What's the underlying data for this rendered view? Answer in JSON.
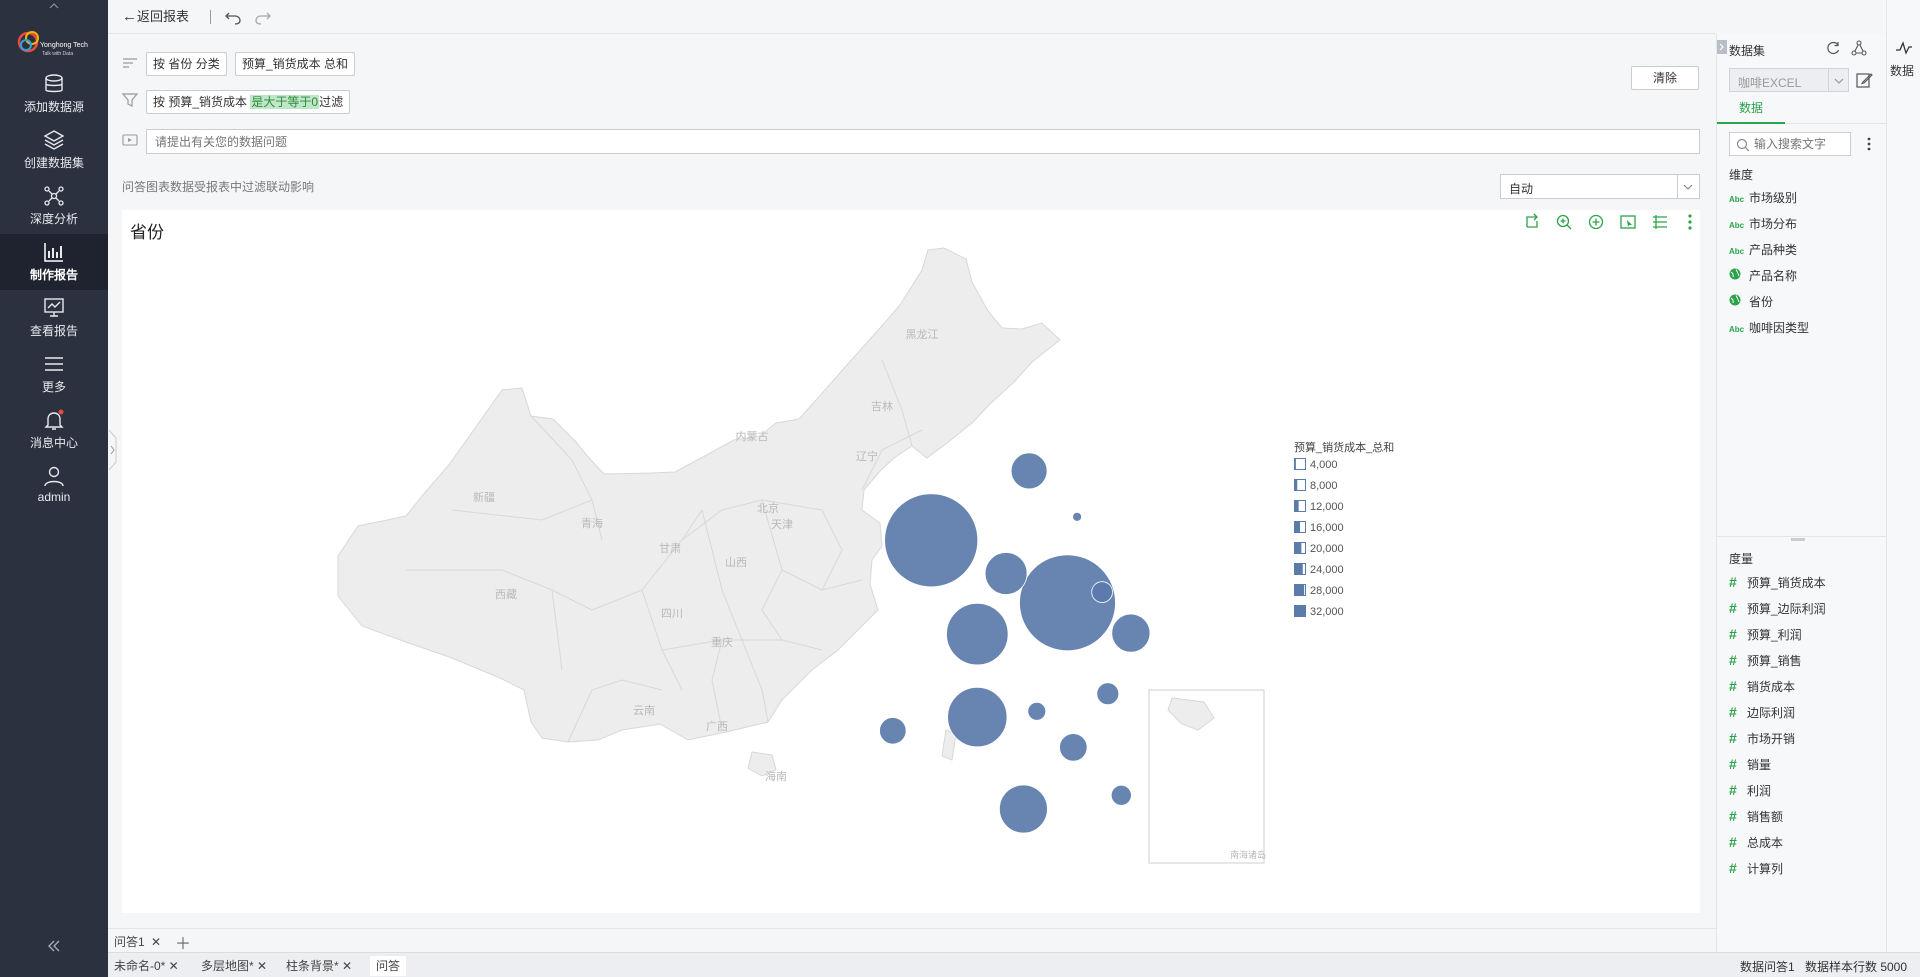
{
  "nav": {
    "items": [
      {
        "label": "添加数据源",
        "icon": "database-icon"
      },
      {
        "label": "创建数据集",
        "icon": "layers-icon"
      },
      {
        "label": "深度分析",
        "icon": "network-icon"
      },
      {
        "label": "制作报告",
        "icon": "bar-chart-icon"
      },
      {
        "label": "查看报告",
        "icon": "monitor-chart-icon"
      },
      {
        "label": "更多",
        "icon": "menu-icon"
      },
      {
        "label": "消息中心",
        "icon": "bell-icon"
      },
      {
        "label": "admin",
        "icon": "user-icon"
      }
    ],
    "logo_line1": "Yonghong Tech",
    "logo_line2": "Talk with Data"
  },
  "topbar": {
    "back_label": "返回报表"
  },
  "query": {
    "chip1_prefix": "按",
    "chip1_field": "省份",
    "chip1_suffix": "分类",
    "chip2": "预算_销货成本 总和",
    "filter_prefix": "按",
    "filter_field": "预算_销货成本",
    "filter_cond": "是大于等于0",
    "filter_suffix": "过滤",
    "clear_label": "清除",
    "question_placeholder": "请提出有关您的数据问题",
    "note": "问答图表数据受报表中过滤联动影响",
    "chart_type_select": "自动"
  },
  "chart": {
    "title": "省份",
    "legend_title": "预算_销货成本_总和",
    "legend_items": [
      "4,000",
      "8,000",
      "12,000",
      "16,000",
      "20,000",
      "24,000",
      "28,000",
      "32,000"
    ],
    "bubble_color": "#5b7bab",
    "map_fill": "#ededed",
    "map_stroke": "#d8d8d8",
    "inset_label": "南海诸岛",
    "province_labels": [
      {
        "name": "黑龙江"
      },
      {
        "name": "吉林"
      },
      {
        "name": "辽宁"
      },
      {
        "name": "内蒙古"
      },
      {
        "name": "新疆"
      },
      {
        "name": "青海"
      },
      {
        "name": "西藏"
      },
      {
        "name": "甘肃"
      },
      {
        "name": "四川"
      },
      {
        "name": "云南"
      },
      {
        "name": "广西"
      },
      {
        "name": "海南"
      },
      {
        "name": "山西"
      },
      {
        "name": "北京"
      },
      {
        "name": "天津"
      },
      {
        "name": "重庆"
      }
    ]
  },
  "chart_data": {
    "type": "scatter",
    "title": "省份",
    "legend_title": "预算_销货成本_总和",
    "size_legend_values": [
      4000,
      8000,
      12000,
      16000,
      20000,
      24000,
      28000,
      32000
    ],
    "series": [
      {
        "values": [
          {
            "x": 0.485,
            "y": 0.553,
            "size": 32000
          },
          {
            "x": 0.556,
            "y": 0.617,
            "size": 34000
          },
          {
            "x": 0.509,
            "y": 0.649,
            "size": 14000
          },
          {
            "x": 0.509,
            "y": 0.734,
            "size": 13000
          },
          {
            "x": 0.524,
            "y": 0.587,
            "size": 6500
          },
          {
            "x": 0.533,
            "y": 0.828,
            "size": 8500
          },
          {
            "x": 0.536,
            "y": 0.482,
            "size": 4800
          },
          {
            "x": 0.589,
            "y": 0.648,
            "size": 5400
          },
          {
            "x": 0.559,
            "y": 0.765,
            "size": 2800
          },
          {
            "x": 0.465,
            "y": 0.748,
            "size": 2600
          },
          {
            "x": 0.577,
            "y": 0.71,
            "size": 1800
          },
          {
            "x": 0.574,
            "y": 0.606,
            "size": 1600
          },
          {
            "x": 0.584,
            "y": 0.814,
            "size": 1500
          },
          {
            "x": 0.54,
            "y": 0.728,
            "size": 1200
          },
          {
            "x": 0.561,
            "y": 0.529,
            "size": 300
          }
        ]
      }
    ]
  },
  "tabs": {
    "panel_tab": "问答1",
    "report_tabs": [
      "未命名-0*",
      "多层地图*",
      "柱条背景*",
      "问答"
    ]
  },
  "datapanel": {
    "title": "数据集",
    "dataset_select": "咖啡EXCEL",
    "tab_data": "数据",
    "search_placeholder": "输入搜索文字",
    "dim_header": "维度",
    "dimensions": [
      {
        "label": "市场级别",
        "type": "Abc"
      },
      {
        "label": "市场分布",
        "type": "Abc"
      },
      {
        "label": "产品种类",
        "type": "Abc"
      },
      {
        "label": "产品名称",
        "type": "geo"
      },
      {
        "label": "省份",
        "type": "geo"
      },
      {
        "label": "咖啡因类型",
        "type": "Abc"
      }
    ],
    "measure_header": "度量",
    "measures": [
      "预算_销货成本",
      "预算_边际利润",
      "预算_利润",
      "预算_销售",
      "销货成本",
      "边际利润",
      "市场开销",
      "销量",
      "利润",
      "销售额",
      "总成本",
      "计算列"
    ],
    "far_right_label": "数据"
  },
  "status": {
    "left": "数据问答1",
    "right": "数据样本行数 5000"
  },
  "colors": {
    "accent": "#2aa34a",
    "nav_bg": "#2c3140",
    "active_bg": "#1f2330"
  }
}
